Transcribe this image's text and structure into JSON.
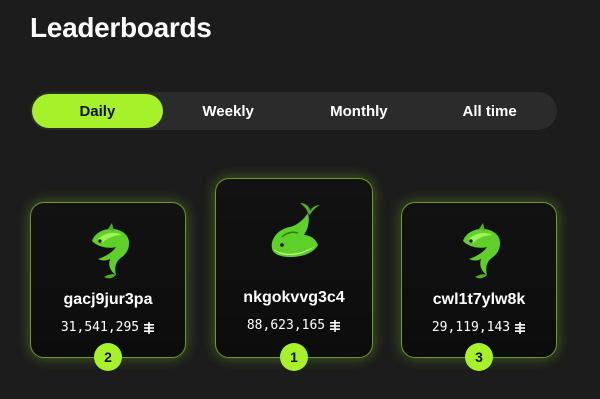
{
  "page": {
    "title": "Leaderboards"
  },
  "tabs": [
    {
      "label": "Daily",
      "active": true
    },
    {
      "label": "Weekly",
      "active": false
    },
    {
      "label": "Monthly",
      "active": false
    },
    {
      "label": "All time",
      "active": false
    }
  ],
  "podium": [
    {
      "rank": "2",
      "username": "gacj9jur3pa",
      "score": "31,541,295",
      "avatar": "dolphin-icon"
    },
    {
      "rank": "1",
      "username": "nkgokvvg3c4",
      "score": "88,623,165",
      "avatar": "whale-icon"
    },
    {
      "rank": "3",
      "username": "cwl1t7ylw8k",
      "score": "29,119,143",
      "avatar": "dolphin-icon"
    }
  ],
  "colors": {
    "accent": "#a6f12a",
    "background": "#1c1c1c",
    "card": "#0f0f0f"
  }
}
